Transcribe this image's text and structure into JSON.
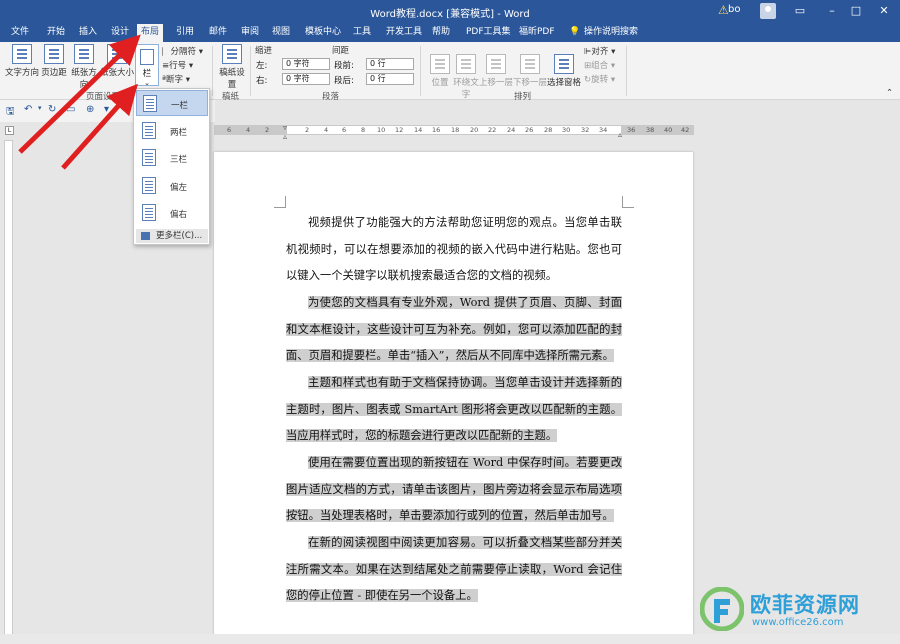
{
  "window": {
    "title": "Word教程.docx [兼容模式] - Word",
    "user": "bo"
  },
  "tabs": [
    "文件",
    "开始",
    "插入",
    "设计",
    "布局",
    "引用",
    "邮件",
    "审阅",
    "视图",
    "模板中心",
    "工具",
    "开发工具",
    "帮助",
    "PDF工具集",
    "福昕PDF",
    "操作说明搜索"
  ],
  "ribbon": {
    "page_setup": {
      "text_direction": "文字方向",
      "margins": "页边距",
      "orientation": "纸张方向",
      "size": "纸张大小",
      "columns": "栏",
      "breaks": "分隔符",
      "line_numbers": "行号",
      "hyphenation": "断字",
      "group_label": "页面设置"
    },
    "manuscript": {
      "label": "稿纸设置",
      "group_label": "稿纸"
    },
    "indent": {
      "title": "缩进",
      "left_label": "左:",
      "left_value": "0 字符",
      "right_label": "右:",
      "right_value": "0 字符"
    },
    "spacing": {
      "title": "间距",
      "before_label": "段前:",
      "before_value": "0 行",
      "after_label": "段后:",
      "after_value": "0 行"
    },
    "paragraph_label": "段落",
    "arrange": {
      "position": "位置",
      "wrap_text": "环绕文字",
      "bring_forward": "上移一层",
      "send_backward": "下移一层",
      "selection_pane": "选择窗格",
      "align": "对齐",
      "group": "组合",
      "rotate": "旋转",
      "group_label": "排列"
    }
  },
  "columns_menu": {
    "items": [
      "一栏",
      "两栏",
      "三栏",
      "偏左",
      "偏右"
    ],
    "more": "更多栏(C)..."
  },
  "ruler": {
    "numbers": [
      "6",
      "4",
      "2",
      "2",
      "4",
      "6",
      "8",
      "10",
      "12",
      "14",
      "16",
      "18",
      "20",
      "22",
      "24",
      "26",
      "28",
      "30",
      "32",
      "34",
      "36",
      "38",
      "40",
      "42"
    ]
  },
  "document": {
    "paragraphs": [
      "视频提供了功能强大的方法帮助您证明您的观点。当您单击联机视频时，可以在想要添加的视频的嵌入代码中进行粘贴。您也可以键入一个关键字以联机搜索最适合您的文档的视频。",
      "为使您的文档具有专业外观，Word 提供了页眉、页脚、封面和文本框设计，这些设计可互为补充。例如，您可以添加匹配的封面、页眉和提要栏。单击“插入”，然后从不同库中选择所需元素。",
      "主题和样式也有助于文档保持协调。当您单击设计并选择新的主题时，图片、图表或 SmartArt 图形将会更改以匹配新的主题。当应用样式时，您的标题会进行更改以匹配新的主题。",
      "使用在需要位置出现的新按钮在 Word 中保存时间。若要更改图片适应文档的方式，请单击该图片，图片旁边将会显示布局选项按钮。当处理表格时，单击要添加行或列的位置，然后单击加号。",
      "在新的阅读视图中阅读更加容易。可以折叠文档某些部分并关注所需文本。如果在达到结尾处之前需要停止读取，Word 会记住您的停止位置 - 即使在另一个设备上。"
    ]
  },
  "watermark": {
    "title": "欧菲资源网",
    "url": "www.office26.com"
  },
  "colors": {
    "accent": "#2b579a",
    "highlight": "#cfcfcf",
    "arrow": "#e02020",
    "watermark": "#2f9fd8"
  }
}
